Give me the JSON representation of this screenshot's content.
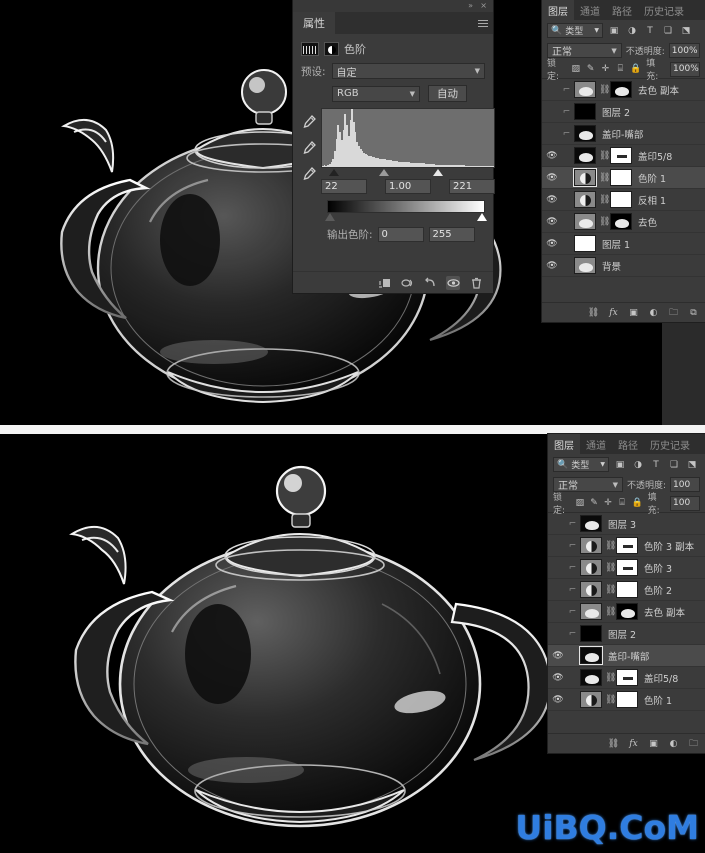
{
  "watermark": {
    "text": "UiBQ.CoM",
    "color": "#2f7de0"
  },
  "canvas": {
    "top_subject": "glass-teapot",
    "bottom_subject": "glass-teapot",
    "background_color": "#000000"
  },
  "properties_panel": {
    "window_controls": {
      "collapse": "»",
      "close": "×"
    },
    "tab_label": "属性",
    "menu_icon": "hamburger-icon",
    "adjustment_title": "色阶",
    "preset": {
      "label": "预设:",
      "value": "自定"
    },
    "channel": {
      "value": "RGB"
    },
    "auto_button": "自动",
    "eyedroppers": [
      "black-point-eyedropper",
      "gray-point-eyedropper",
      "white-point-eyedropper"
    ],
    "input_levels": {
      "black": "22",
      "gamma": "1.00",
      "white": "221"
    },
    "output_levels": {
      "label": "输出色阶:",
      "black": "0",
      "white": "255"
    },
    "footer_icons": [
      "clip-to-layer-icon",
      "view-previous-state-icon",
      "reset-icon",
      "toggle-visibility-icon",
      "delete-icon"
    ],
    "histogram_bars": [
      2,
      3,
      2,
      4,
      5,
      8,
      14,
      26,
      46,
      70,
      58,
      44,
      62,
      88,
      70,
      52,
      78,
      96,
      74,
      58,
      42,
      34,
      30,
      26,
      24,
      22,
      20,
      19,
      18,
      17,
      16,
      15,
      15,
      14,
      14,
      13,
      13,
      12,
      12,
      11,
      11,
      10,
      10,
      10,
      9,
      9,
      9,
      8,
      8,
      8,
      8,
      7,
      7,
      7,
      7,
      6,
      6,
      6,
      6,
      6,
      5,
      5,
      5,
      5,
      5,
      5,
      4,
      4,
      4,
      4,
      4,
      4,
      4,
      3,
      3,
      3,
      3,
      3,
      3,
      3,
      3,
      3,
      3,
      2,
      2,
      2,
      2,
      2,
      2,
      2,
      2,
      2,
      2,
      2,
      2,
      2,
      1,
      1,
      1,
      1
    ]
  },
  "layers_panel_top": {
    "tabs": [
      "图层",
      "通道",
      "路径",
      "历史记录"
    ],
    "active_tab": "图层",
    "filter": {
      "search_icon": "search-icon",
      "kind_label": "类型",
      "icons": [
        "image-filter-icon",
        "adjustment-filter-icon",
        "text-filter-icon",
        "shape-filter-icon",
        "smart-object-filter-icon"
      ]
    },
    "blend": {
      "mode": "正常",
      "opacity_label": "不透明度:",
      "opacity_value": "100%"
    },
    "lock": {
      "label": "锁定:",
      "icons": [
        "lock-transparency-icon",
        "lock-paint-icon",
        "lock-move-icon",
        "lock-artboard-icon",
        "lock-all-icon"
      ],
      "fill_label": "填充:",
      "fill_value": "100%"
    },
    "layers": [
      {
        "name": "去色 副本",
        "visible": false,
        "clipped": true,
        "thumb": "pot",
        "mask": "pot-mask",
        "linked": true,
        "selected": false
      },
      {
        "name": "图层 2",
        "visible": false,
        "clipped": true,
        "thumb": "black",
        "mask": null,
        "linked": false,
        "selected": false
      },
      {
        "name": "盖印-嘴部",
        "visible": false,
        "clipped": true,
        "thumb": "potdark",
        "mask": null,
        "linked": false,
        "selected": false
      },
      {
        "name": "盖印5/8",
        "visible": true,
        "clipped": false,
        "thumb": "potdark",
        "mask": "bar-mask",
        "linked": true,
        "selected": false
      },
      {
        "name": "色阶 1",
        "visible": true,
        "clipped": false,
        "thumb": "halfmoon",
        "mask": "white-mask",
        "linked": true,
        "selected": true
      },
      {
        "name": "反相 1",
        "visible": true,
        "clipped": false,
        "thumb": "halfmoon",
        "mask": "white-mask",
        "linked": true,
        "selected": false
      },
      {
        "name": "去色",
        "visible": true,
        "clipped": false,
        "thumb": "pot",
        "mask": "pot-mask",
        "linked": true,
        "selected": false
      },
      {
        "name": "图层 1",
        "visible": true,
        "clipped": false,
        "thumb": "white",
        "mask": null,
        "linked": false,
        "selected": false
      },
      {
        "name": "背景",
        "visible": true,
        "clipped": false,
        "thumb": "pot",
        "mask": null,
        "linked": false,
        "selected": false
      }
    ],
    "footer_icons": [
      "link-layers-icon",
      "layer-style-icon",
      "layer-mask-icon",
      "adjustment-layer-icon",
      "new-group-icon",
      "new-layer-icon"
    ]
  },
  "layers_panel_bottom": {
    "tabs": [
      "图层",
      "通道",
      "路径",
      "历史记录"
    ],
    "active_tab": "图层",
    "filter": {
      "search_icon": "search-icon",
      "kind_label": "类型",
      "icons": [
        "image-filter-icon",
        "adjustment-filter-icon",
        "text-filter-icon",
        "shape-filter-icon",
        "smart-object-filter-icon"
      ]
    },
    "blend": {
      "mode": "正常",
      "opacity_label": "不透明度:",
      "opacity_value": "100"
    },
    "lock": {
      "label": "锁定:",
      "icons": [
        "lock-transparency-icon",
        "lock-paint-icon",
        "lock-move-icon",
        "lock-artboard-icon",
        "lock-all-icon"
      ],
      "fill_label": "填充:",
      "fill_value": "100"
    },
    "layers": [
      {
        "name": "图层 3",
        "visible": false,
        "clipped": true,
        "thumb": "potdark",
        "mask": null,
        "linked": false,
        "selected": false
      },
      {
        "name": "色阶 3 副本",
        "visible": false,
        "clipped": true,
        "thumb": "halfmoon",
        "mask": "bar-mask",
        "linked": true,
        "selected": false
      },
      {
        "name": "色阶 3",
        "visible": false,
        "clipped": true,
        "thumb": "halfmoon",
        "mask": "bar-mask",
        "linked": true,
        "selected": false
      },
      {
        "name": "色阶 2",
        "visible": false,
        "clipped": true,
        "thumb": "halfmoon",
        "mask": "white-mask",
        "linked": true,
        "selected": false
      },
      {
        "name": "去色 副本",
        "visible": false,
        "clipped": true,
        "thumb": "pot",
        "mask": "pot-mask",
        "linked": true,
        "selected": false
      },
      {
        "name": "图层 2",
        "visible": false,
        "clipped": true,
        "thumb": "black",
        "mask": null,
        "linked": false,
        "selected": false
      },
      {
        "name": "盖印-嘴部",
        "visible": true,
        "clipped": false,
        "thumb": "potdark",
        "mask": null,
        "linked": false,
        "selected": true
      },
      {
        "name": "盖印5/8",
        "visible": true,
        "clipped": false,
        "thumb": "potdark",
        "mask": "bar-mask",
        "linked": true,
        "selected": false
      },
      {
        "name": "色阶 1",
        "visible": true,
        "clipped": false,
        "thumb": "halfmoon",
        "mask": "white-mask",
        "linked": true,
        "selected": false
      }
    ],
    "footer_icons": [
      "link-layers-icon",
      "layer-style-icon",
      "layer-mask-icon",
      "adjustment-layer-icon",
      "new-group-icon"
    ]
  }
}
